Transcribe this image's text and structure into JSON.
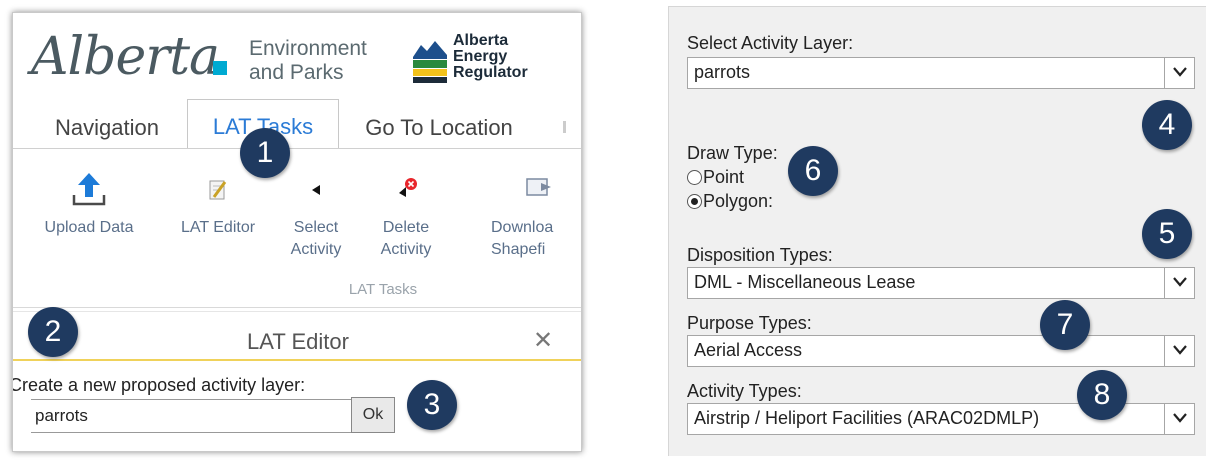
{
  "left": {
    "logo": {
      "alberta_script": "Alberta",
      "ministry_line1": "Environment",
      "ministry_line2": "and Parks",
      "aer_line1": "Alberta",
      "aer_line2": "Energy",
      "aer_line3": "Regulator"
    },
    "tabs": [
      {
        "label": "Navigation"
      },
      {
        "label": "LAT Tasks"
      },
      {
        "label": "Go To Location"
      }
    ],
    "ribbon": {
      "buttons": [
        {
          "label": "Upload Data",
          "icon": "upload-arrow-icon"
        },
        {
          "label": "LAT Editor",
          "icon": "edit-pencil-icon"
        },
        {
          "label_line1": "Select",
          "label_line2": "Activity",
          "icon": "cursor-arrow-icon"
        },
        {
          "label_line1": "Delete",
          "label_line2": "Activity",
          "icon": "delete-cursor-icon"
        },
        {
          "label_line1": "Downloa",
          "label_line2": "Shapefi",
          "icon": "export-icon"
        }
      ],
      "group_label": "LAT Tasks"
    },
    "editor": {
      "title": "LAT Editor",
      "close_glyph": "✕",
      "create_label": "Create a new proposed activity layer:",
      "input_value": "parrots",
      "ok_label": "Ok"
    }
  },
  "right": {
    "activity_layer_label": "Select Activity Layer:",
    "activity_layer_value": "parrots",
    "draw_type_label": "Draw Type:",
    "draw_options": [
      {
        "label": "Point",
        "checked": false
      },
      {
        "label": "Polygon:",
        "checked": true
      }
    ],
    "disposition_label": "Disposition Types:",
    "disposition_value": "DML - Miscellaneous Lease",
    "purpose_label": "Purpose Types:",
    "purpose_value": "Aerial Access",
    "activity_types_label": "Activity Types:",
    "activity_types_value": "Airstrip / Heliport Facilities (ARAC02DMLP)"
  },
  "badges": [
    "1",
    "2",
    "3",
    "4",
    "5",
    "6",
    "7",
    "8"
  ],
  "colors": {
    "badge": "#1f3a60",
    "active_tab": "#2b7bd6",
    "ribbon_text": "#5a6f8a",
    "editor_underline": "#f0d25a",
    "alberta_blue": "#00aad2"
  }
}
